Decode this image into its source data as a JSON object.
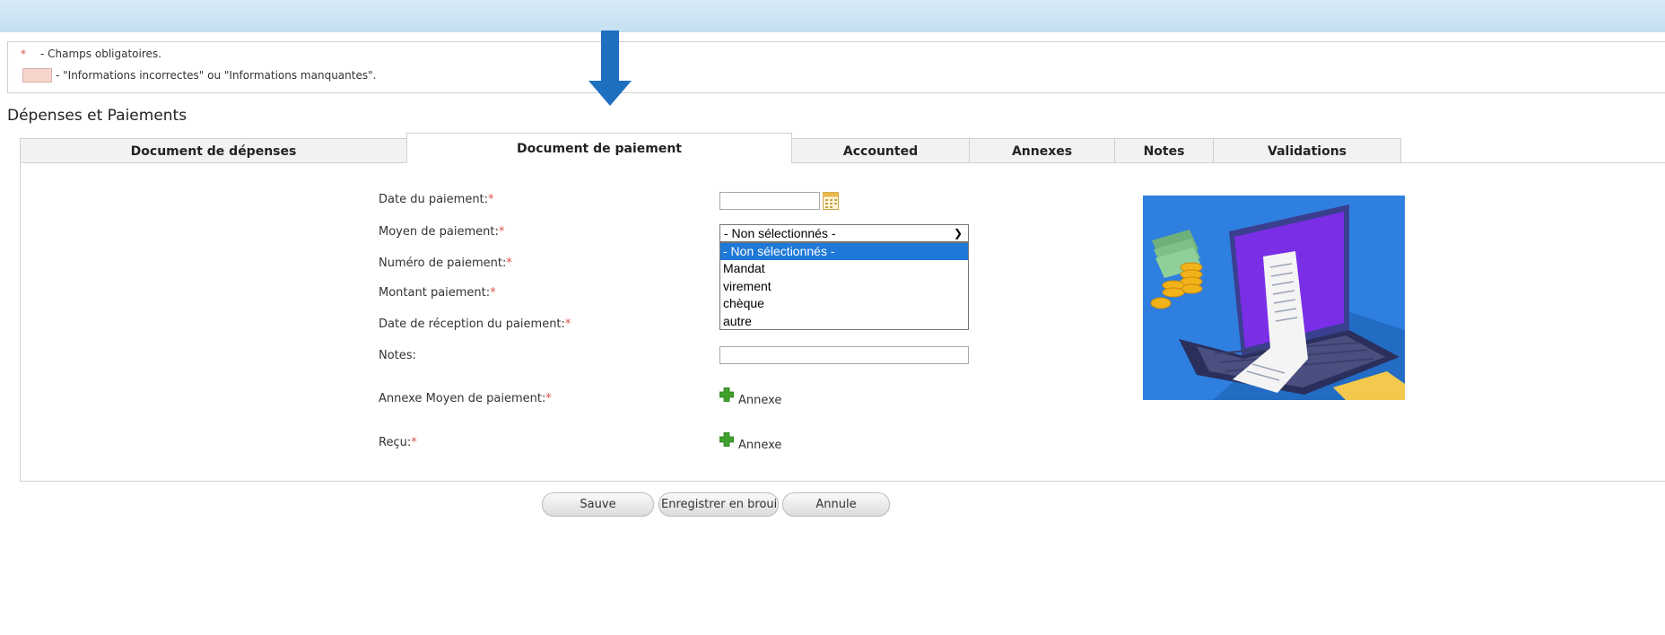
{
  "legend": {
    "required_marker": "*",
    "required_text": "- Champs obligatoires.",
    "error_text": "- \"Informations incorrectes\" ou \"Informations manquantes\"."
  },
  "section_title": "Dépenses et Paiements",
  "tabs": [
    {
      "label": "Document de dépenses",
      "active": false
    },
    {
      "label": "Document de paiement",
      "active": true
    },
    {
      "label": "Accounted",
      "active": false
    },
    {
      "label": "Annexes",
      "active": false
    },
    {
      "label": "Notes",
      "active": false
    },
    {
      "label": "Validations",
      "active": false
    }
  ],
  "form": {
    "required_star": "*",
    "date_paiement_label": "Date du paiement:",
    "date_paiement_value": "",
    "moyen_paiement_label": "Moyen de paiement:",
    "moyen_paiement_selected": "- Non sélectionnés -",
    "moyen_paiement_options": [
      "- Non sélectionnés -",
      "Mandat",
      "virement",
      "chèque",
      "autre"
    ],
    "numero_paiement_label": "Numéro de paiement:",
    "montant_paiement_label": "Montant paiement:",
    "date_reception_label": "Date de réception du paiement:",
    "notes_label": "Notes:",
    "notes_value": "",
    "annexe_moyen_label": "Annexe Moyen de paiement:",
    "recu_label": "Reçu:",
    "annexe_link_text": "Annexe"
  },
  "buttons": {
    "save": "Sauve",
    "draft": "Enregistrer en brouillon",
    "cancel": "Annule"
  },
  "colors": {
    "required": "#d9534f",
    "error_swatch": "#f7d4cc",
    "arrow": "#1f6fc1",
    "dropdown_selected": "#1e78d7",
    "top_bar": "#cfe6f4"
  },
  "icons": {
    "calendar": "calendar-icon",
    "plus": "plus-icon",
    "arrow": "arrow-down-icon",
    "illustration": "payment-illustration"
  }
}
